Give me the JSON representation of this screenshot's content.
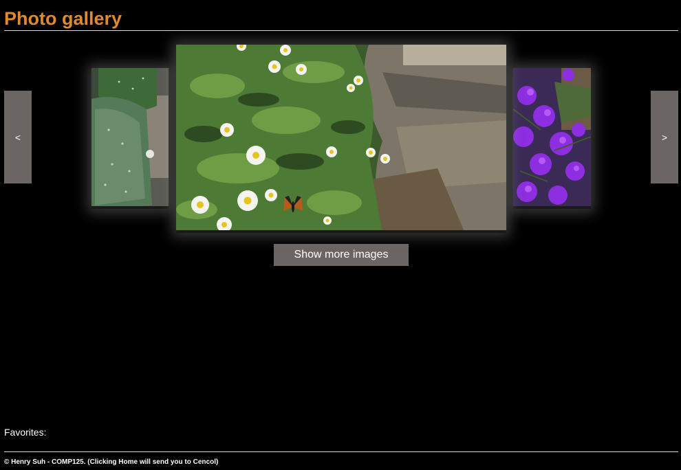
{
  "header": {
    "title": "Photo gallery"
  },
  "gallery": {
    "prev_label": "<",
    "next_label": ">",
    "show_more_label": "Show more images",
    "photos": [
      {
        "subject": "cactus",
        "position": "previous"
      },
      {
        "subject": "daisies-and-butterfly",
        "position": "current"
      },
      {
        "subject": "purple-flowers",
        "position": "next"
      }
    ]
  },
  "favorites": {
    "label": "Favorites:"
  },
  "footer": {
    "text": "© Henry Suh - COMP125. (Clicking Home will send you to Cencol)"
  },
  "colors": {
    "title": "#e08a2c",
    "button_bg": "#6b6563",
    "background": "#000000"
  }
}
